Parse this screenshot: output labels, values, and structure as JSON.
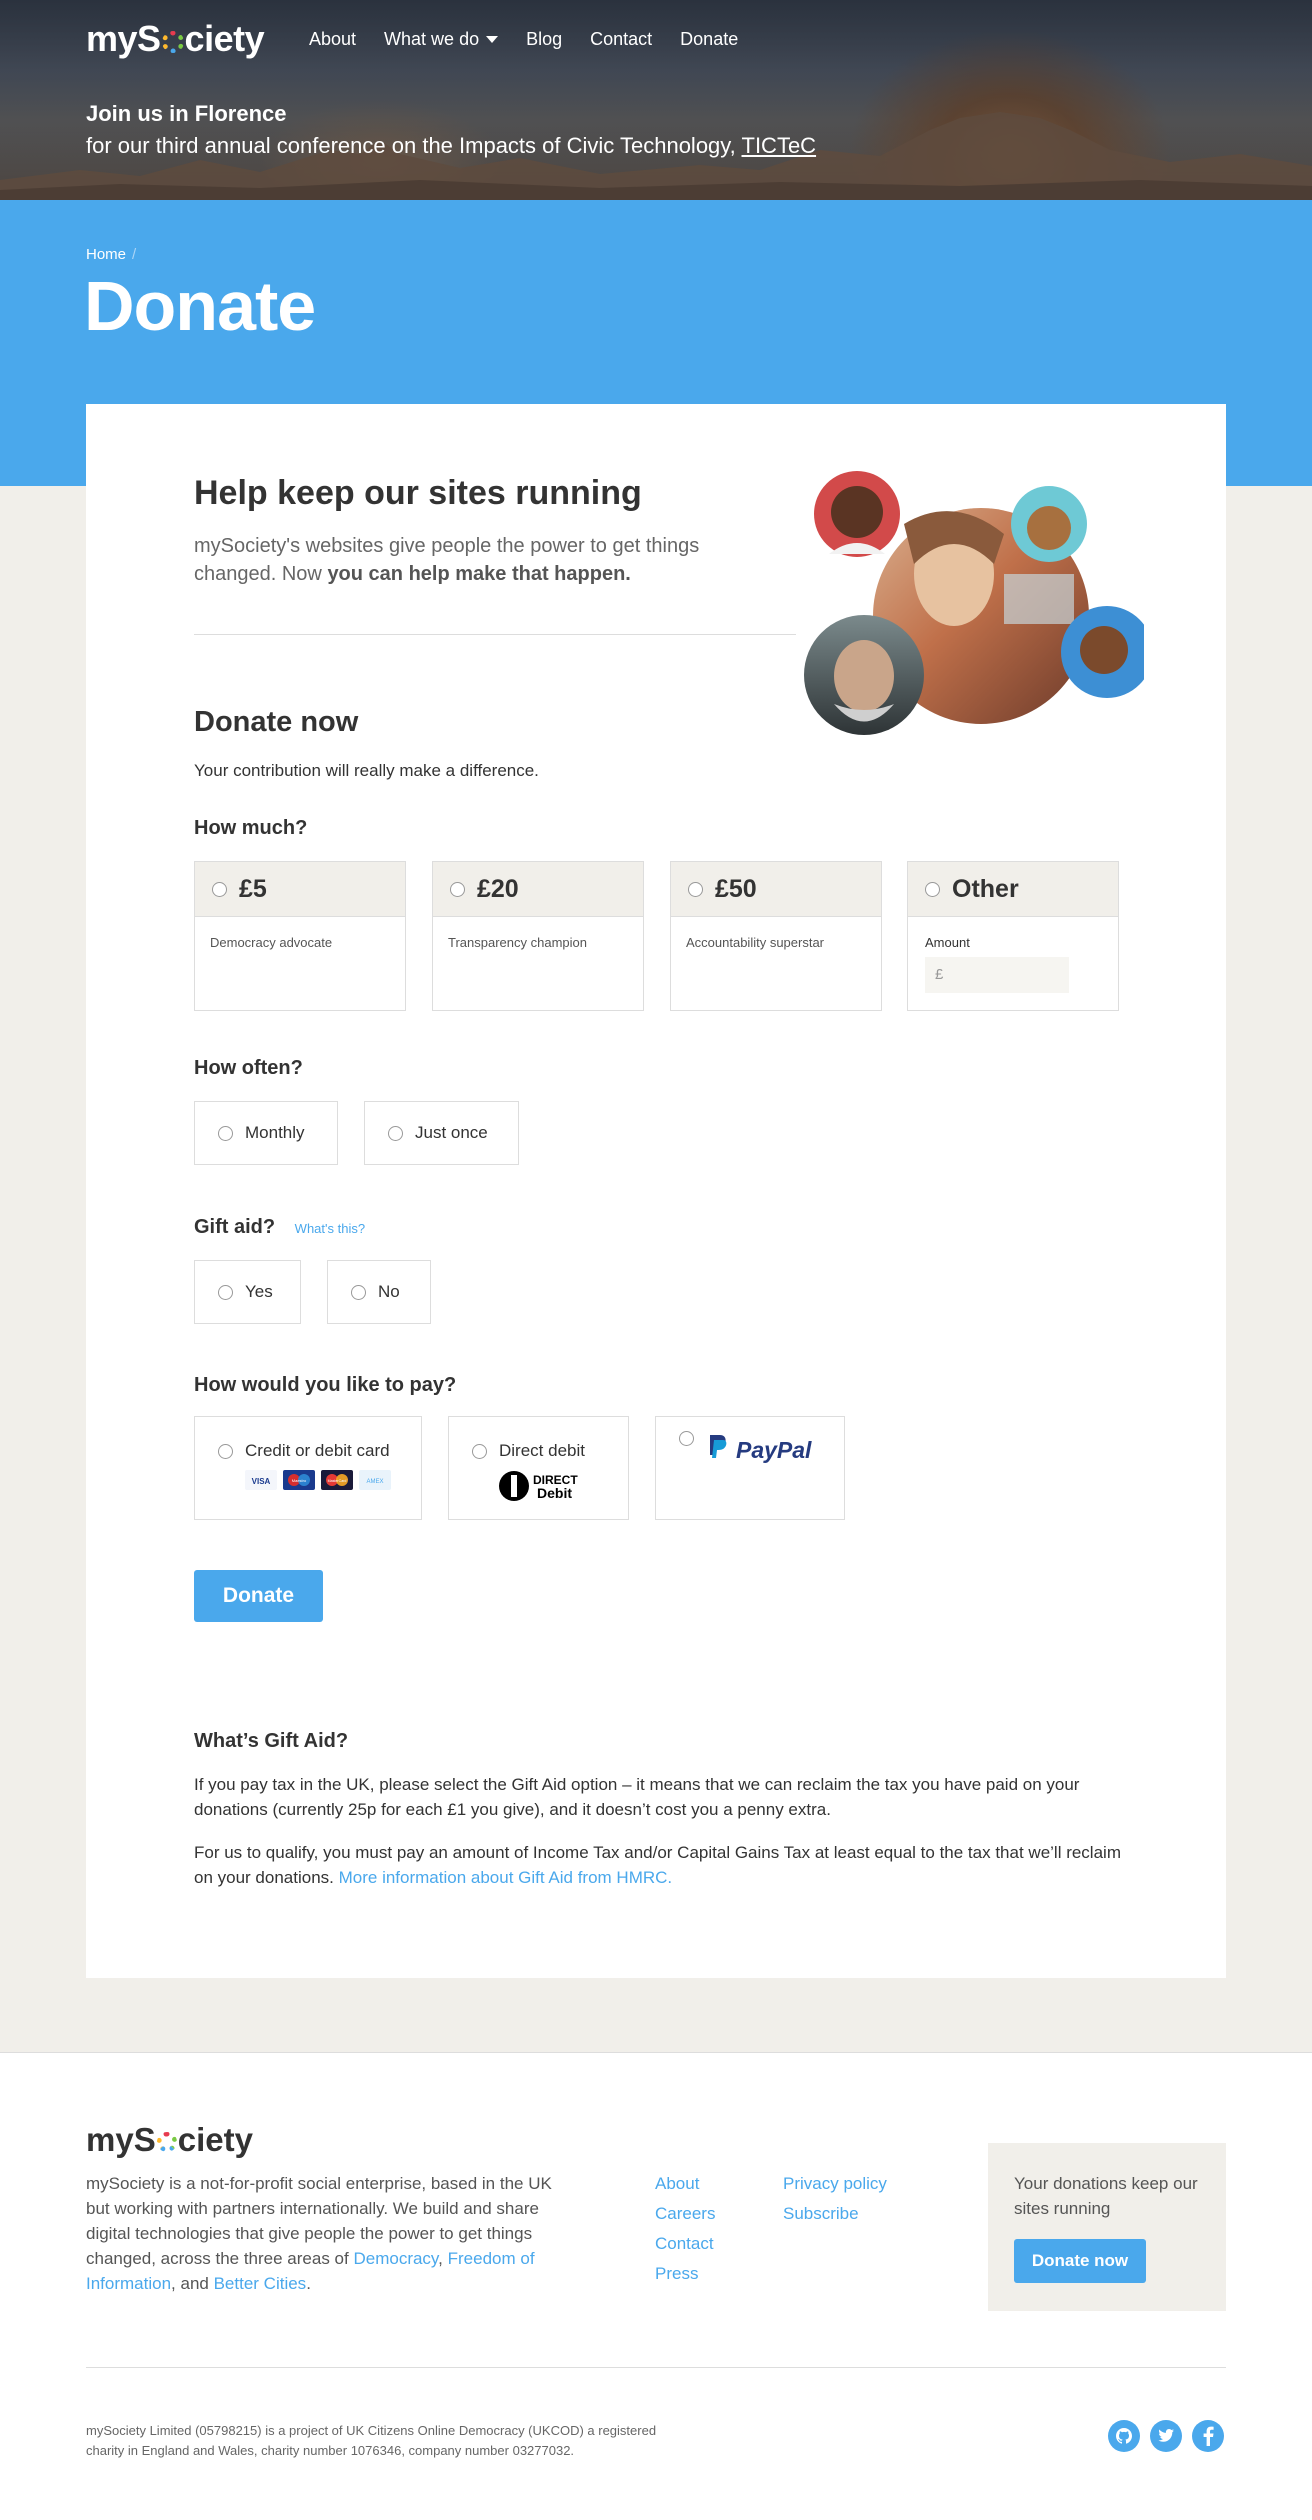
{
  "header": {
    "logo_text": "mySociety",
    "nav": [
      "About",
      "What we do",
      "Blog",
      "Contact",
      "Donate"
    ],
    "banner_line1": "Join us in Florence",
    "banner_line2": "for our third annual conference on the Impacts of Civic Technology,",
    "banner_link": "TICTeC"
  },
  "page": {
    "breadcrumb": "Home",
    "breadcrumb_sep": "/",
    "title": "Donate"
  },
  "intro": {
    "heading": "Help keep our sites running",
    "text": "mySociety's websites give people the power to get things changed. Now",
    "text_bold": "you can help make that happen."
  },
  "donate": {
    "heading": "Donate now",
    "subtitle": "Your contribution will really make a difference.",
    "how_much": "How much?",
    "amounts": [
      {
        "value": "£5",
        "desc": "Democracy advocate"
      },
      {
        "value": "£20",
        "desc": "Transparency champion"
      },
      {
        "value": "£50",
        "desc": "Accountability superstar"
      },
      {
        "value": "Other",
        "desc": "Amount"
      }
    ],
    "other_placeholder": "£",
    "how_often": "How often?",
    "frequency": [
      "Monthly",
      "Just once"
    ],
    "gift_aid": "Gift aid?",
    "whats_this": "What's this?",
    "gift_aid_options": [
      "Yes",
      "No"
    ],
    "pay_method_q": "How would you like to pay?",
    "pay_methods": [
      "Credit or debit card",
      "Direct debit",
      "PayPal"
    ],
    "card_logos": [
      "VISA",
      "Maestro",
      "MasterCard",
      "AMEX"
    ],
    "direct_debit_logo_top": "DIRECT",
    "direct_debit_logo_bottom": "Debit",
    "submit": "Donate"
  },
  "gift_aid_info": {
    "heading": "What’s Gift Aid?",
    "p1": "If you pay tax in the UK, please select the Gift Aid option – it means that we can reclaim the tax you have paid on your donations (currently 25p for each £1 you give), and it doesn’t cost you a penny extra.",
    "p2": "For us to qualify, you must pay an amount of Income Tax and/or Capital Gains Tax at least equal to the tax that we’ll reclaim on your donations.",
    "p2_link": "More information about Gift Aid from HMRC."
  },
  "footer": {
    "logo_text": "mySociety",
    "about_text": "mySociety is a not-for-profit social enterprise, based in the UK but working with partners internationally. We build and share digital technologies that give people the power to get things changed, across the three areas of",
    "about_links": [
      "Democracy",
      "Freedom of Information",
      "Better Cities"
    ],
    "about_comma": ",",
    "about_and": ", and",
    "about_end": ".",
    "col1": [
      "About",
      "Careers",
      "Contact",
      "Press"
    ],
    "col2": [
      "Privacy policy",
      "Subscribe"
    ],
    "cta_text": "Your donations keep our sites running",
    "cta_button": "Donate now",
    "legal": "mySociety Limited (05798215) is a project of UK Citizens Online Democracy (UKCOD) a registered charity in England and Wales, charity number 1076346, company number 03277032.",
    "social": [
      "github-icon",
      "twitter-icon",
      "facebook-icon"
    ]
  },
  "colors": {
    "accent": "#4aa8ec",
    "background": "#f1efea",
    "text": "#333333"
  }
}
